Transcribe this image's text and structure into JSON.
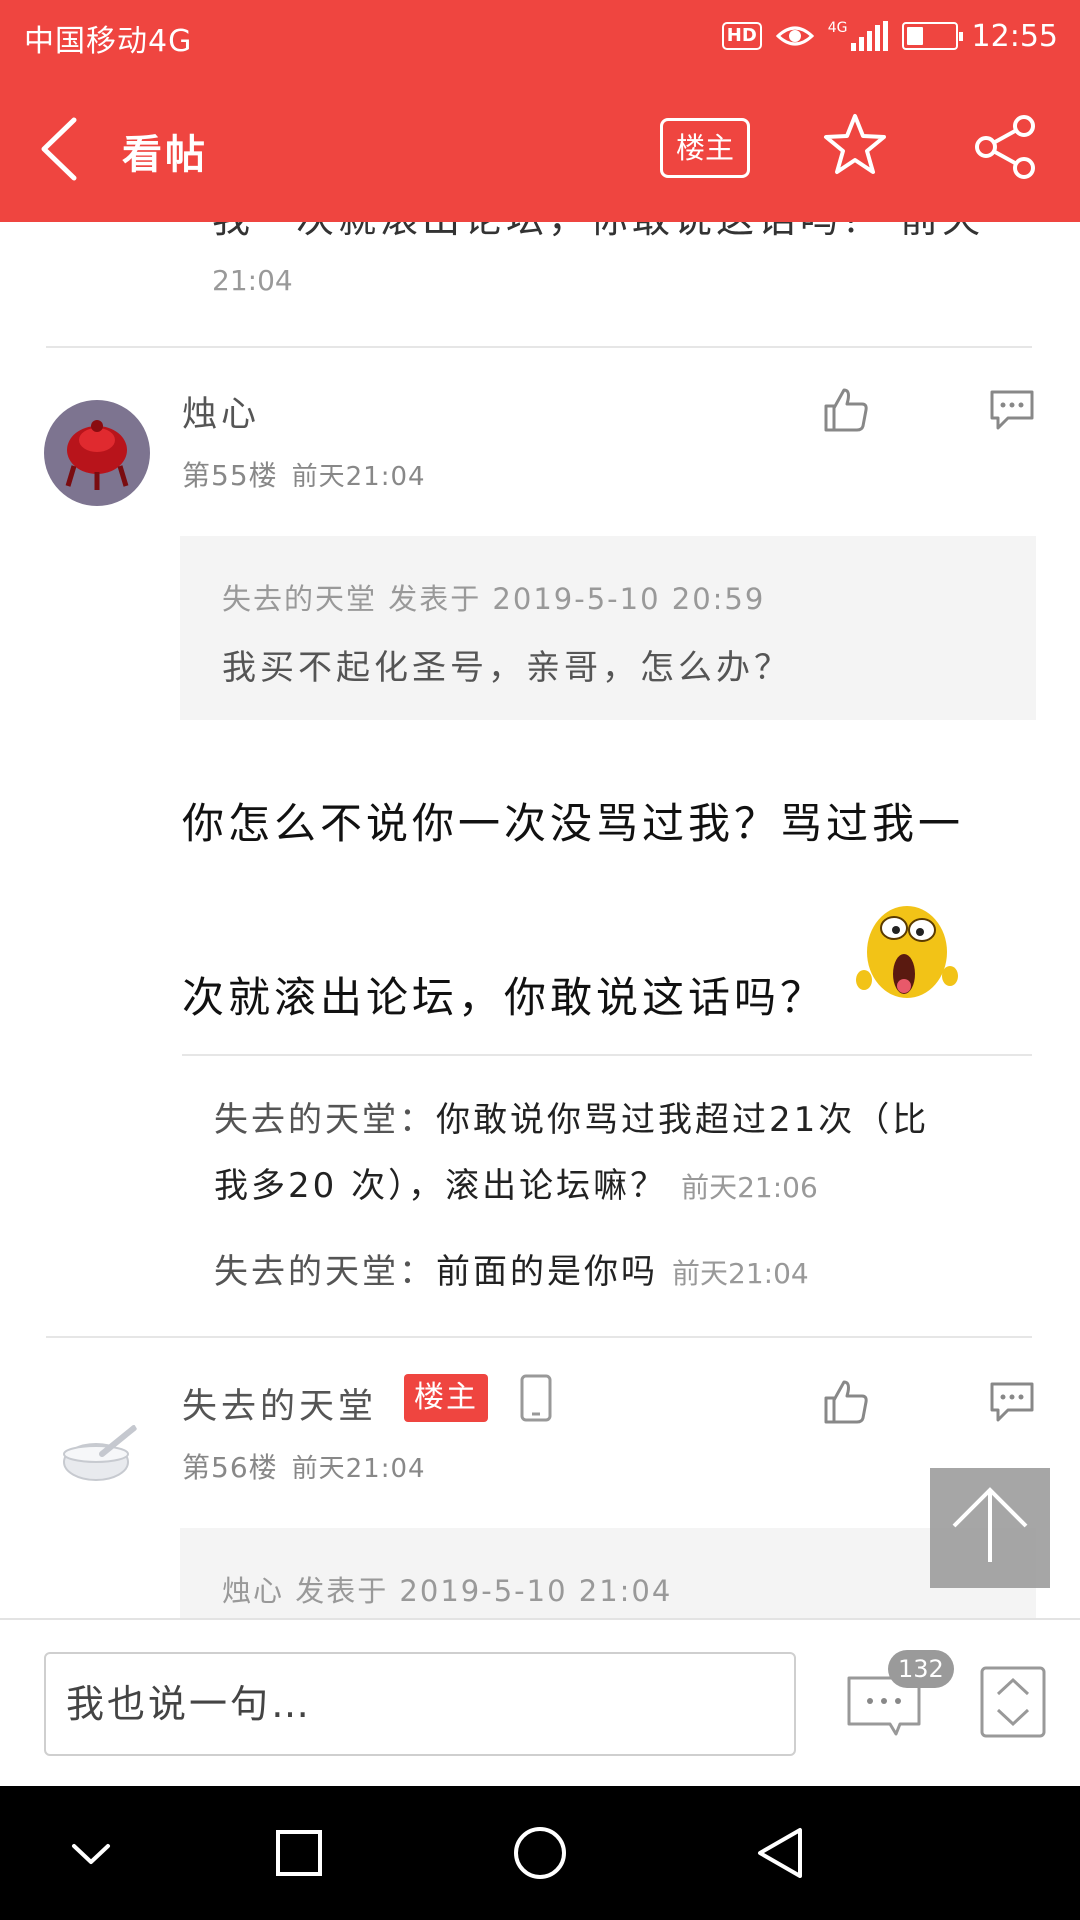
{
  "status_bar": {
    "carrier": "中国移动4G",
    "hd": "HD",
    "network": "4G",
    "battery_level": 0.35,
    "time": "12:55"
  },
  "header": {
    "title": "看帖",
    "owner_button": "楼主",
    "icons": [
      "back-icon",
      "star-icon",
      "share-icon"
    ]
  },
  "previous_post": {
    "text_tail": "我一次就滚出论坛，你敢说这话吗？ 前天",
    "time": "21:04"
  },
  "posts": [
    {
      "username": "烛心",
      "floor": "第55楼",
      "time": "前天21:04",
      "quote": {
        "meta": "失去的天堂 发表于 2019-5-10 20:59",
        "text": "我买不起化圣号，亲哥，怎么办？"
      },
      "body_lines": [
        "你怎么不说你一次没骂过我？骂过我一",
        "次就滚出论坛，你敢说这话吗？"
      ],
      "replies": [
        {
          "user": "失去的天堂：",
          "line1": "你敢说你骂过我超过21次（比",
          "line2": "我多20 次），滚出论坛嘛？",
          "time": "前天21:06"
        },
        {
          "user": "失去的天堂：",
          "text": "前面的是你吗",
          "time": "前天21:04"
        }
      ]
    },
    {
      "username": "失去的天堂",
      "owner_tag": "楼主",
      "floor": "第56楼",
      "time": "前天21:04",
      "quote": {
        "meta": "烛心 发表于 2019-5-10 21:04"
      }
    }
  ],
  "input_bar": {
    "placeholder": "我也说一句…",
    "comment_count": "132"
  },
  "colors": {
    "brand_red": "#ef4540",
    "quote_bg": "#f4f4f4",
    "muted_text": "#999999"
  }
}
